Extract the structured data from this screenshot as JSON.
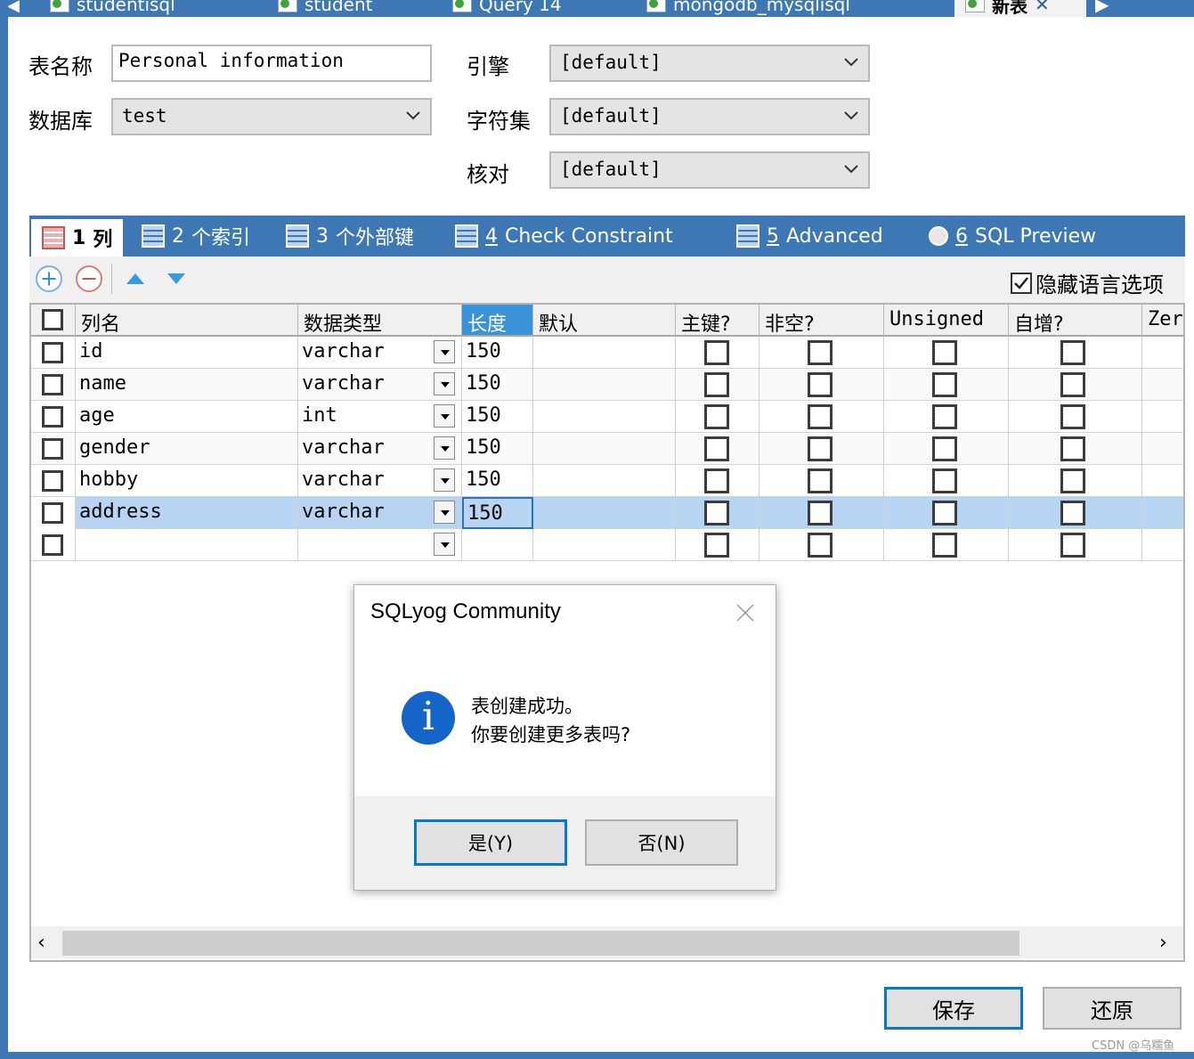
{
  "window_tabs": [
    {
      "label": "studentisql"
    },
    {
      "label": "student"
    },
    {
      "label": "Query 14"
    },
    {
      "label": "mongodb_mysqlisql"
    },
    {
      "label": "新表",
      "active": true
    }
  ],
  "form": {
    "table_name_label": "表名称",
    "table_name_value": "Personal information",
    "database_label": "数据库",
    "database_value": "test",
    "engine_label": "引擎",
    "engine_value": "[default]",
    "charset_label": "字符集",
    "charset_value": "[default]",
    "collation_label": "核对",
    "collation_value": "[default]"
  },
  "panel_tabs": [
    {
      "num": "1",
      "label": "列",
      "active": true
    },
    {
      "num": "2",
      "label": "个索引"
    },
    {
      "num": "3",
      "label": "个外部键"
    },
    {
      "num": "4",
      "label": "Check Constraint"
    },
    {
      "num": "5",
      "label": "Advanced"
    },
    {
      "num": "6",
      "label": "SQL Preview"
    }
  ],
  "toolbar": {
    "hide_language_options_label": "隐藏语言选项",
    "hide_language_options_checked": true
  },
  "grid": {
    "headers": {
      "name": "列名",
      "type": "数据类型",
      "length": "长度",
      "default": "默认",
      "pk": "主键?",
      "notnull": "非空?",
      "unsigned": "Unsigned",
      "autoinc": "自增?",
      "zerofill": "Zer"
    },
    "rows": [
      {
        "name": "id",
        "type": "varchar",
        "length": "150",
        "default": ""
      },
      {
        "name": "name",
        "type": "varchar",
        "length": "150",
        "default": ""
      },
      {
        "name": "age",
        "type": "int",
        "length": "150",
        "default": ""
      },
      {
        "name": "gender",
        "type": "varchar",
        "length": "150",
        "default": ""
      },
      {
        "name": "hobby",
        "type": "varchar",
        "length": "150",
        "default": ""
      },
      {
        "name": "address",
        "type": "varchar",
        "length": "150",
        "default": "",
        "selected": true
      },
      {
        "name": "",
        "type": "",
        "length": "",
        "default": ""
      }
    ]
  },
  "dialog": {
    "title": "SQLyog Community",
    "message_line1": "表创建成功。",
    "message_line2": "你要创建更多表吗?",
    "yes_label": "是(Y)",
    "no_label": "否(N)"
  },
  "buttons": {
    "save_label": "保存",
    "revert_label": "还原"
  },
  "watermark": "CSDN @乌糯鱼",
  "colors": {
    "accent": "#3d78b5",
    "header_selected": "#3a93d8",
    "row_selected": "#b7d5f2",
    "info_icon": "#1565c8",
    "dialog_default_border": "#0078d7"
  }
}
